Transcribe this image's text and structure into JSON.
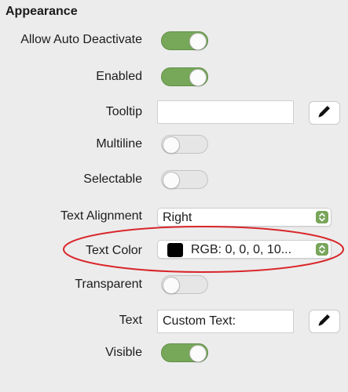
{
  "section": {
    "title": "Appearance"
  },
  "rows": {
    "allow_auto_deactivate": {
      "label": "Allow Auto Deactivate",
      "state": "on"
    },
    "enabled": {
      "label": "Enabled",
      "state": "on"
    },
    "tooltip": {
      "label": "Tooltip",
      "value": ""
    },
    "multiline": {
      "label": "Multiline",
      "state": "off"
    },
    "selectable": {
      "label": "Selectable",
      "state": "off"
    },
    "text_alignment": {
      "label": "Text Alignment",
      "value": "Right"
    },
    "text_color": {
      "label": "Text Color",
      "value": "RGB: 0, 0, 0, 10...",
      "swatch": "#000000"
    },
    "transparent": {
      "label": "Transparent",
      "state": "off"
    },
    "text": {
      "label": "Text",
      "value": "Custom Text:"
    },
    "visible": {
      "label": "Visible",
      "state": "on"
    }
  },
  "icons": {
    "edit": "pencil-icon",
    "stepper": "up-down-chevron-icon"
  },
  "colors": {
    "toggle_on": "#77a85a",
    "toggle_off": "#e6e6e6",
    "annotation": "#d9262a",
    "background": "#ececec"
  }
}
